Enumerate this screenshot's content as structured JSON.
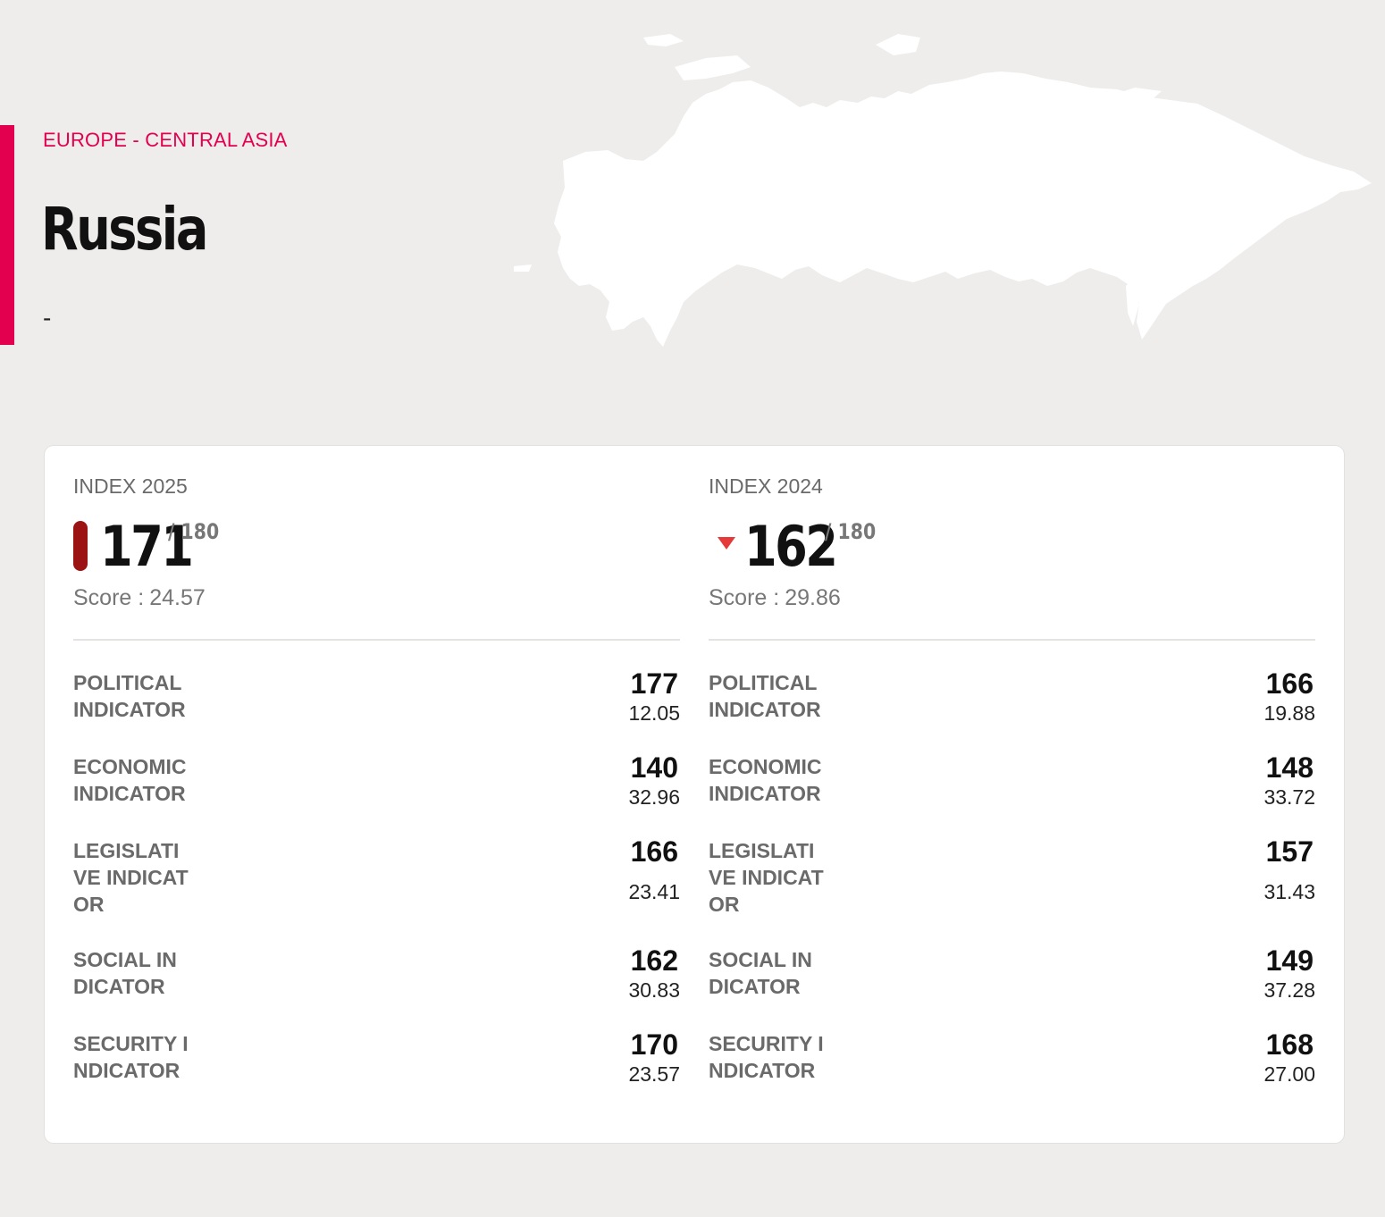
{
  "region": "EUROPE - CENTRAL ASIA",
  "country": "Russia",
  "subtitle": "-",
  "colors": {
    "accent": "#e3004f",
    "rank_pill": "#9b1313",
    "down_arrow": "#e43a3a",
    "background": "#eeedec"
  },
  "index_2025": {
    "label": "INDEX 2025",
    "rank": "171",
    "total": "/ 180",
    "score_label": "Score :",
    "score": "24.57",
    "indicators": [
      {
        "label": "POLITICAL INDICATOR",
        "rank": "177",
        "score": "12.05"
      },
      {
        "label": "ECONOMIC INDICATOR",
        "rank": "140",
        "score": "32.96"
      },
      {
        "label": "LEGISLATIVE INDICATOR",
        "rank": "166",
        "score": "23.41"
      },
      {
        "label": "SOCIAL INDICATOR",
        "rank": "162",
        "score": "30.83"
      },
      {
        "label": "SECURITY INDICATOR",
        "rank": "170",
        "score": "23.57"
      }
    ]
  },
  "index_2024": {
    "label": "INDEX 2024",
    "rank": "162",
    "total": "/ 180",
    "score_label": "Score :",
    "score": "29.86",
    "trend_icon": "down-triangle-icon",
    "indicators": [
      {
        "label": "POLITICAL INDICATOR",
        "rank": "166",
        "score": "19.88"
      },
      {
        "label": "ECONOMIC INDICATOR",
        "rank": "148",
        "score": "33.72"
      },
      {
        "label": "LEGISLATIVE INDICATOR",
        "rank": "157",
        "score": "31.43"
      },
      {
        "label": "SOCIAL INDICATOR",
        "rank": "149",
        "score": "37.28"
      },
      {
        "label": "SECURITY INDICATOR",
        "rank": "168",
        "score": "27.00"
      }
    ]
  }
}
